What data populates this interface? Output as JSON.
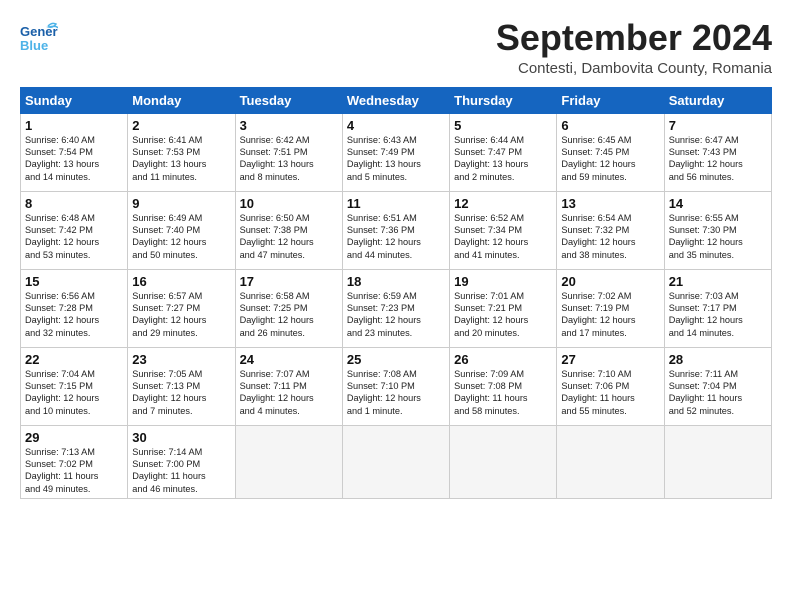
{
  "header": {
    "logo_general": "General",
    "logo_blue": "Blue",
    "month": "September 2024",
    "location": "Contesti, Dambovita County, Romania"
  },
  "weekdays": [
    "Sunday",
    "Monday",
    "Tuesday",
    "Wednesday",
    "Thursday",
    "Friday",
    "Saturday"
  ],
  "weeks": [
    [
      {
        "day": "1",
        "lines": [
          "Sunrise: 6:40 AM",
          "Sunset: 7:54 PM",
          "Daylight: 13 hours",
          "and 14 minutes."
        ]
      },
      {
        "day": "2",
        "lines": [
          "Sunrise: 6:41 AM",
          "Sunset: 7:53 PM",
          "Daylight: 13 hours",
          "and 11 minutes."
        ]
      },
      {
        "day": "3",
        "lines": [
          "Sunrise: 6:42 AM",
          "Sunset: 7:51 PM",
          "Daylight: 13 hours",
          "and 8 minutes."
        ]
      },
      {
        "day": "4",
        "lines": [
          "Sunrise: 6:43 AM",
          "Sunset: 7:49 PM",
          "Daylight: 13 hours",
          "and 5 minutes."
        ]
      },
      {
        "day": "5",
        "lines": [
          "Sunrise: 6:44 AM",
          "Sunset: 7:47 PM",
          "Daylight: 13 hours",
          "and 2 minutes."
        ]
      },
      {
        "day": "6",
        "lines": [
          "Sunrise: 6:45 AM",
          "Sunset: 7:45 PM",
          "Daylight: 12 hours",
          "and 59 minutes."
        ]
      },
      {
        "day": "7",
        "lines": [
          "Sunrise: 6:47 AM",
          "Sunset: 7:43 PM",
          "Daylight: 12 hours",
          "and 56 minutes."
        ]
      }
    ],
    [
      {
        "day": "8",
        "lines": [
          "Sunrise: 6:48 AM",
          "Sunset: 7:42 PM",
          "Daylight: 12 hours",
          "and 53 minutes."
        ]
      },
      {
        "day": "9",
        "lines": [
          "Sunrise: 6:49 AM",
          "Sunset: 7:40 PM",
          "Daylight: 12 hours",
          "and 50 minutes."
        ]
      },
      {
        "day": "10",
        "lines": [
          "Sunrise: 6:50 AM",
          "Sunset: 7:38 PM",
          "Daylight: 12 hours",
          "and 47 minutes."
        ]
      },
      {
        "day": "11",
        "lines": [
          "Sunrise: 6:51 AM",
          "Sunset: 7:36 PM",
          "Daylight: 12 hours",
          "and 44 minutes."
        ]
      },
      {
        "day": "12",
        "lines": [
          "Sunrise: 6:52 AM",
          "Sunset: 7:34 PM",
          "Daylight: 12 hours",
          "and 41 minutes."
        ]
      },
      {
        "day": "13",
        "lines": [
          "Sunrise: 6:54 AM",
          "Sunset: 7:32 PM",
          "Daylight: 12 hours",
          "and 38 minutes."
        ]
      },
      {
        "day": "14",
        "lines": [
          "Sunrise: 6:55 AM",
          "Sunset: 7:30 PM",
          "Daylight: 12 hours",
          "and 35 minutes."
        ]
      }
    ],
    [
      {
        "day": "15",
        "lines": [
          "Sunrise: 6:56 AM",
          "Sunset: 7:28 PM",
          "Daylight: 12 hours",
          "and 32 minutes."
        ]
      },
      {
        "day": "16",
        "lines": [
          "Sunrise: 6:57 AM",
          "Sunset: 7:27 PM",
          "Daylight: 12 hours",
          "and 29 minutes."
        ]
      },
      {
        "day": "17",
        "lines": [
          "Sunrise: 6:58 AM",
          "Sunset: 7:25 PM",
          "Daylight: 12 hours",
          "and 26 minutes."
        ]
      },
      {
        "day": "18",
        "lines": [
          "Sunrise: 6:59 AM",
          "Sunset: 7:23 PM",
          "Daylight: 12 hours",
          "and 23 minutes."
        ]
      },
      {
        "day": "19",
        "lines": [
          "Sunrise: 7:01 AM",
          "Sunset: 7:21 PM",
          "Daylight: 12 hours",
          "and 20 minutes."
        ]
      },
      {
        "day": "20",
        "lines": [
          "Sunrise: 7:02 AM",
          "Sunset: 7:19 PM",
          "Daylight: 12 hours",
          "and 17 minutes."
        ]
      },
      {
        "day": "21",
        "lines": [
          "Sunrise: 7:03 AM",
          "Sunset: 7:17 PM",
          "Daylight: 12 hours",
          "and 14 minutes."
        ]
      }
    ],
    [
      {
        "day": "22",
        "lines": [
          "Sunrise: 7:04 AM",
          "Sunset: 7:15 PM",
          "Daylight: 12 hours",
          "and 10 minutes."
        ]
      },
      {
        "day": "23",
        "lines": [
          "Sunrise: 7:05 AM",
          "Sunset: 7:13 PM",
          "Daylight: 12 hours",
          "and 7 minutes."
        ]
      },
      {
        "day": "24",
        "lines": [
          "Sunrise: 7:07 AM",
          "Sunset: 7:11 PM",
          "Daylight: 12 hours",
          "and 4 minutes."
        ]
      },
      {
        "day": "25",
        "lines": [
          "Sunrise: 7:08 AM",
          "Sunset: 7:10 PM",
          "Daylight: 12 hours",
          "and 1 minute."
        ]
      },
      {
        "day": "26",
        "lines": [
          "Sunrise: 7:09 AM",
          "Sunset: 7:08 PM",
          "Daylight: 11 hours",
          "and 58 minutes."
        ]
      },
      {
        "day": "27",
        "lines": [
          "Sunrise: 7:10 AM",
          "Sunset: 7:06 PM",
          "Daylight: 11 hours",
          "and 55 minutes."
        ]
      },
      {
        "day": "28",
        "lines": [
          "Sunrise: 7:11 AM",
          "Sunset: 7:04 PM",
          "Daylight: 11 hours",
          "and 52 minutes."
        ]
      }
    ],
    [
      {
        "day": "29",
        "lines": [
          "Sunrise: 7:13 AM",
          "Sunset: 7:02 PM",
          "Daylight: 11 hours",
          "and 49 minutes."
        ]
      },
      {
        "day": "30",
        "lines": [
          "Sunrise: 7:14 AM",
          "Sunset: 7:00 PM",
          "Daylight: 11 hours",
          "and 46 minutes."
        ]
      },
      {
        "day": "",
        "lines": []
      },
      {
        "day": "",
        "lines": []
      },
      {
        "day": "",
        "lines": []
      },
      {
        "day": "",
        "lines": []
      },
      {
        "day": "",
        "lines": []
      }
    ]
  ]
}
